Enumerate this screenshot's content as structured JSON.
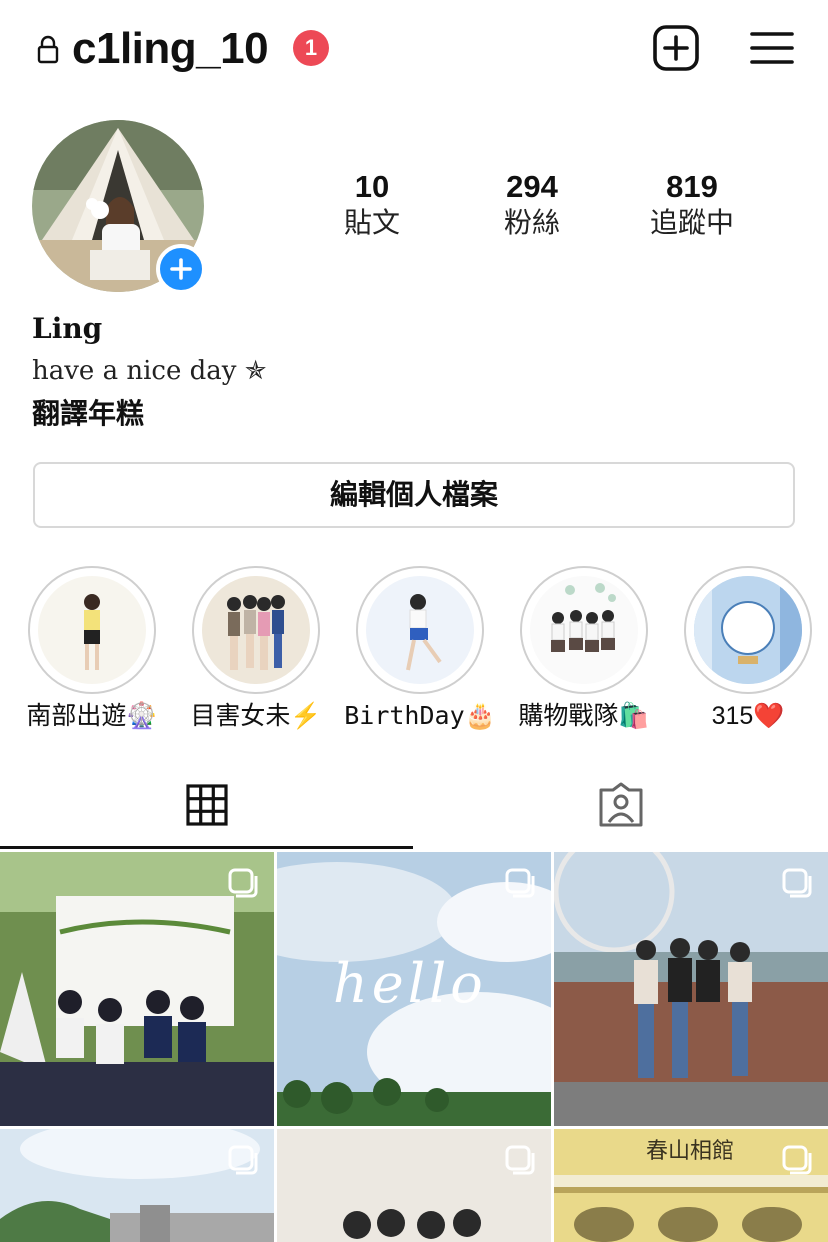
{
  "header": {
    "username": "c1ling_10",
    "notification_count": "1"
  },
  "stats": [
    {
      "value": "10",
      "label": "貼文"
    },
    {
      "value": "294",
      "label": "粉絲"
    },
    {
      "value": "819",
      "label": "追蹤中"
    }
  ],
  "profile": {
    "name": "Ling",
    "bio_line1": "have a nice day ✯",
    "bio_line2": "翻譯年糕"
  },
  "edit_profile_label": "編輯個人檔案",
  "highlights": [
    {
      "label": "南部出遊🎡"
    },
    {
      "label": "目害女未⚡️"
    },
    {
      "label": "BirthDay🎂"
    },
    {
      "label": "購物戰隊🛍️"
    },
    {
      "label": "315❤️"
    }
  ],
  "grid": {
    "overlay_text_post2": "hello",
    "sign_text_post6": "春山相館"
  },
  "colors": {
    "badge": "#ed4956",
    "add_story": "#1e90ff"
  }
}
